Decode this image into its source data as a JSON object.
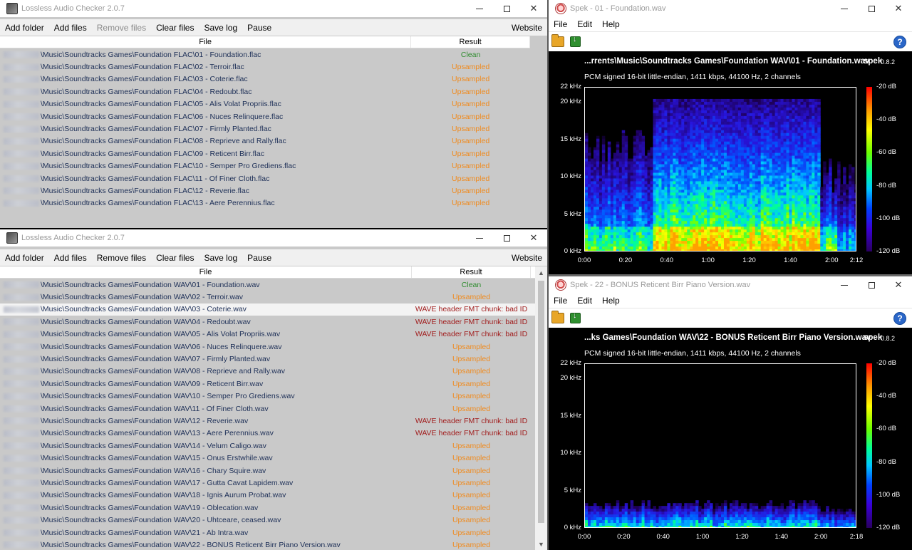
{
  "lac_top": {
    "title": "Lossless Audio Checker 2.0.7",
    "menu": [
      "Add folder",
      "Add files",
      "Remove files",
      "Clear files",
      "Save log",
      "Pause"
    ],
    "menu_right": "Website",
    "columns": {
      "file": "File",
      "result": "Result"
    },
    "rows": [
      {
        "path": "\\Music\\Soundtracks Games\\Foundation FLAC\\01 - Foundation.flac",
        "result": "Clean"
      },
      {
        "path": "\\Music\\Soundtracks Games\\Foundation FLAC\\02 - Terroir.flac",
        "result": "Upsampled"
      },
      {
        "path": "\\Music\\Soundtracks Games\\Foundation FLAC\\03 - Coterie.flac",
        "result": "Upsampled"
      },
      {
        "path": "\\Music\\Soundtracks Games\\Foundation FLAC\\04 - Redoubt.flac",
        "result": "Upsampled"
      },
      {
        "path": "\\Music\\Soundtracks Games\\Foundation FLAC\\05 - Alis Volat Propriis.flac",
        "result": "Upsampled"
      },
      {
        "path": "\\Music\\Soundtracks Games\\Foundation FLAC\\06 - Nuces Relinquere.flac",
        "result": "Upsampled"
      },
      {
        "path": "\\Music\\Soundtracks Games\\Foundation FLAC\\07 - Firmly Planted.flac",
        "result": "Upsampled"
      },
      {
        "path": "\\Music\\Soundtracks Games\\Foundation FLAC\\08 - Reprieve and Rally.flac",
        "result": "Upsampled"
      },
      {
        "path": "\\Music\\Soundtracks Games\\Foundation FLAC\\09 - Reticent Birr.flac",
        "result": "Upsampled"
      },
      {
        "path": "\\Music\\Soundtracks Games\\Foundation FLAC\\10 - Semper Pro Grediens.flac",
        "result": "Upsampled"
      },
      {
        "path": "\\Music\\Soundtracks Games\\Foundation FLAC\\11 - Of Finer Cloth.flac",
        "result": "Upsampled"
      },
      {
        "path": "\\Music\\Soundtracks Games\\Foundation FLAC\\12 - Reverie.flac",
        "result": "Upsampled"
      },
      {
        "path": "\\Music\\Soundtracks Games\\Foundation FLAC\\13 - Aere Perennius.flac",
        "result": "Upsampled"
      }
    ]
  },
  "lac_bottom": {
    "title": "Lossless Audio Checker 2.0.7",
    "menu": [
      "Add folder",
      "Add files",
      "Remove files",
      "Clear files",
      "Save log",
      "Pause"
    ],
    "menu_right": "Website",
    "columns": {
      "file": "File",
      "result": "Result"
    },
    "rows": [
      {
        "path": "\\Music\\Soundtracks Games\\Foundation WAV\\01 - Foundation.wav",
        "result": "Clean"
      },
      {
        "path": "\\Music\\Soundtracks Games\\Foundation WAV\\02 - Terroir.wav",
        "result": "Upsampled"
      },
      {
        "path": "\\Music\\Soundtracks Games\\Foundation WAV\\03 - Coterie.wav",
        "result": "WAVE header FMT chunk: bad ID"
      },
      {
        "path": "\\Music\\Soundtracks Games\\Foundation WAV\\04 - Redoubt.wav",
        "result": "WAVE header FMT chunk: bad ID"
      },
      {
        "path": "\\Music\\Soundtracks Games\\Foundation WAV\\05 - Alis Volat Propriis.wav",
        "result": "WAVE header FMT chunk: bad ID"
      },
      {
        "path": "\\Music\\Soundtracks Games\\Foundation WAV\\06 - Nuces Relinquere.wav",
        "result": "Upsampled"
      },
      {
        "path": "\\Music\\Soundtracks Games\\Foundation WAV\\07 - Firmly Planted.wav",
        "result": "Upsampled"
      },
      {
        "path": "\\Music\\Soundtracks Games\\Foundation WAV\\08 - Reprieve and Rally.wav",
        "result": "Upsampled"
      },
      {
        "path": "\\Music\\Soundtracks Games\\Foundation WAV\\09 - Reticent Birr.wav",
        "result": "Upsampled"
      },
      {
        "path": "\\Music\\Soundtracks Games\\Foundation WAV\\10 - Semper Pro Grediens.wav",
        "result": "Upsampled"
      },
      {
        "path": "\\Music\\Soundtracks Games\\Foundation WAV\\11 - Of Finer Cloth.wav",
        "result": "Upsampled"
      },
      {
        "path": "\\Music\\Soundtracks Games\\Foundation WAV\\12 - Reverie.wav",
        "result": "WAVE header FMT chunk: bad ID"
      },
      {
        "path": "\\Music\\Soundtracks Games\\Foundation WAV\\13 - Aere Perennius.wav",
        "result": "WAVE header FMT chunk: bad ID"
      },
      {
        "path": "\\Music\\Soundtracks Games\\Foundation WAV\\14 - Velum Caligo.wav",
        "result": "Upsampled"
      },
      {
        "path": "\\Music\\Soundtracks Games\\Foundation WAV\\15 - Onus Erstwhile.wav",
        "result": "Upsampled"
      },
      {
        "path": "\\Music\\Soundtracks Games\\Foundation WAV\\16 - Chary Squire.wav",
        "result": "Upsampled"
      },
      {
        "path": "\\Music\\Soundtracks Games\\Foundation WAV\\17 - Gutta Cavat Lapidem.wav",
        "result": "Upsampled"
      },
      {
        "path": "\\Music\\Soundtracks Games\\Foundation WAV\\18 - Ignis Aurum Probat.wav",
        "result": "Upsampled"
      },
      {
        "path": "\\Music\\Soundtracks Games\\Foundation WAV\\19 - Oblecation.wav",
        "result": "Upsampled"
      },
      {
        "path": "\\Music\\Soundtracks Games\\Foundation WAV\\20 - Uhtceare, ceased.wav",
        "result": "Upsampled"
      },
      {
        "path": "\\Music\\Soundtracks Games\\Foundation WAV\\21 - Ab Intra.wav",
        "result": "Upsampled"
      },
      {
        "path": "\\Music\\Soundtracks Games\\Foundation WAV\\22 - BONUS Reticent Birr Piano Version.wav",
        "result": "Upsampled"
      }
    ]
  },
  "spek_top": {
    "title": "Spek - 01 - Foundation.wav",
    "menu": [
      "File",
      "Edit",
      "Help"
    ],
    "file_label": "...rrents\\Music\\Soundtracks Games\\Foundation WAV\\01 - Foundation.wav",
    "app_name": "spek",
    "version": "0.8.2",
    "info": "PCM signed 16-bit little-endian, 1411 kbps, 44100 Hz, 2 channels",
    "y_ticks": [
      "22 kHz",
      "20 kHz",
      "15 kHz",
      "10 kHz",
      "5 kHz",
      "0 kHz"
    ],
    "x_ticks": [
      "0:00",
      "0:20",
      "0:40",
      "1:00",
      "1:20",
      "1:40",
      "2:00",
      "2:12"
    ],
    "db_ticks": [
      "-20 dB",
      "-40 dB",
      "-60 dB",
      "-80 dB",
      "-100 dB",
      "-120 dB"
    ]
  },
  "spek_bottom": {
    "title": "Spek - 22 - BONUS Reticent Birr Piano Version.wav",
    "menu": [
      "File",
      "Edit",
      "Help"
    ],
    "file_label": "...ks Games\\Foundation WAV\\22 - BONUS Reticent Birr Piano Version.wav",
    "app_name": "spek",
    "version": "0.8.2",
    "info": "PCM signed 16-bit little-endian, 1411 kbps, 44100 Hz, 2 channels",
    "y_ticks": [
      "22 kHz",
      "20 kHz",
      "15 kHz",
      "10 kHz",
      "5 kHz",
      "0 kHz"
    ],
    "x_ticks": [
      "0:00",
      "0:20",
      "0:40",
      "1:00",
      "1:20",
      "1:40",
      "2:00",
      "2:18"
    ],
    "db_ticks": [
      "-20 dB",
      "-40 dB",
      "-60 dB",
      "-80 dB",
      "-100 dB",
      "-120 dB"
    ]
  },
  "colors": {
    "clean": "#2f8c2f",
    "upsampled": "#f08a1d",
    "error": "#a11d1d",
    "path": "#1d2f57"
  },
  "icons": [
    "lac-app-icon",
    "spek-app-icon",
    "open-folder-icon",
    "save-image-icon",
    "help-icon",
    "minimize-icon",
    "maximize-icon",
    "close-icon"
  ]
}
